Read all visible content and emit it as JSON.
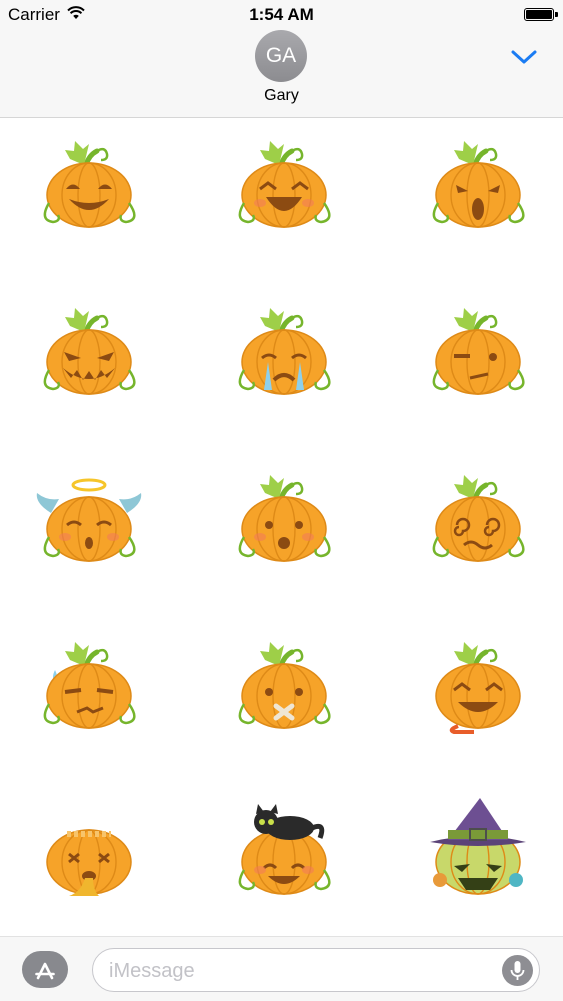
{
  "status_bar": {
    "carrier": "Carrier",
    "time": "1:54 AM"
  },
  "conversation": {
    "avatar_initials": "GA",
    "contact_name": "Gary"
  },
  "stickers": [
    {
      "name": "sticker-grin"
    },
    {
      "name": "sticker-laugh"
    },
    {
      "name": "sticker-shocked"
    },
    {
      "name": "sticker-evil-grin"
    },
    {
      "name": "sticker-crying"
    },
    {
      "name": "sticker-suspicious"
    },
    {
      "name": "sticker-angel"
    },
    {
      "name": "sticker-surprised"
    },
    {
      "name": "sticker-dizzy"
    },
    {
      "name": "sticker-annoyed"
    },
    {
      "name": "sticker-mouth-taped"
    },
    {
      "name": "sticker-drooling"
    },
    {
      "name": "sticker-sick"
    },
    {
      "name": "sticker-black-cat"
    },
    {
      "name": "sticker-witch-hat"
    }
  ],
  "compose": {
    "placeholder": "iMessage"
  },
  "icons": {
    "wifi": "wifi-icon",
    "battery": "battery-icon",
    "collapse": "chevron-down-icon",
    "app_store": "app-store-icon",
    "microphone": "microphone-icon"
  },
  "colors": {
    "accent": "#1b7cf3",
    "pumpkin": "#f6a329",
    "stem": "#76b52c"
  }
}
